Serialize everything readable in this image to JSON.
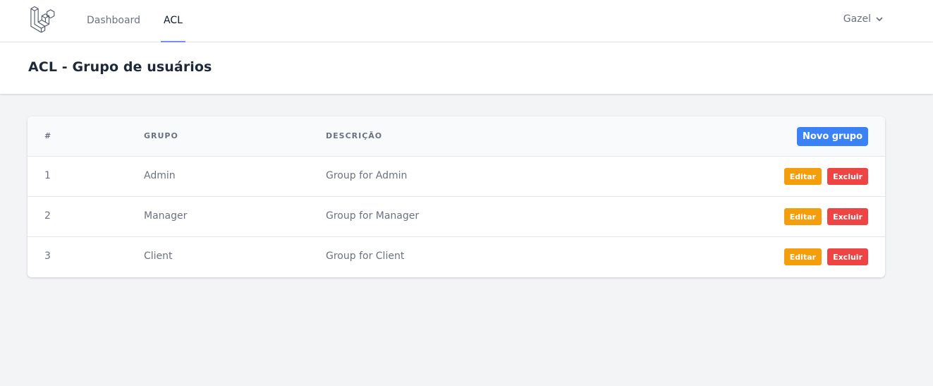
{
  "nav": {
    "logo_icon": "laravel-logo-icon",
    "links": [
      {
        "label": "Dashboard",
        "active": false
      },
      {
        "label": "ACL",
        "active": true
      }
    ],
    "user": {
      "name": "Gazel",
      "icon": "chevron-down-icon"
    }
  },
  "header": {
    "title": "ACL - Grupo de usuários"
  },
  "table": {
    "columns": [
      "#",
      "Grupo",
      "Descrição"
    ],
    "new_button_label": "Novo grupo",
    "rows": [
      {
        "id": "1",
        "group": "Admin",
        "description": "Group for Admin",
        "edit_label": "Editar",
        "delete_label": "Excluir"
      },
      {
        "id": "2",
        "group": "Manager",
        "description": "Group for Manager",
        "edit_label": "Editar",
        "delete_label": "Excluir"
      },
      {
        "id": "3",
        "group": "Client",
        "description": "Group for Client",
        "edit_label": "Editar",
        "delete_label": "Excluir"
      }
    ]
  },
  "colors": {
    "accent": "#818cf8",
    "primary_button": "#3b82f6",
    "edit_button": "#f59e0b",
    "delete_button": "#ef4444",
    "page_background": "#f3f4f6"
  }
}
